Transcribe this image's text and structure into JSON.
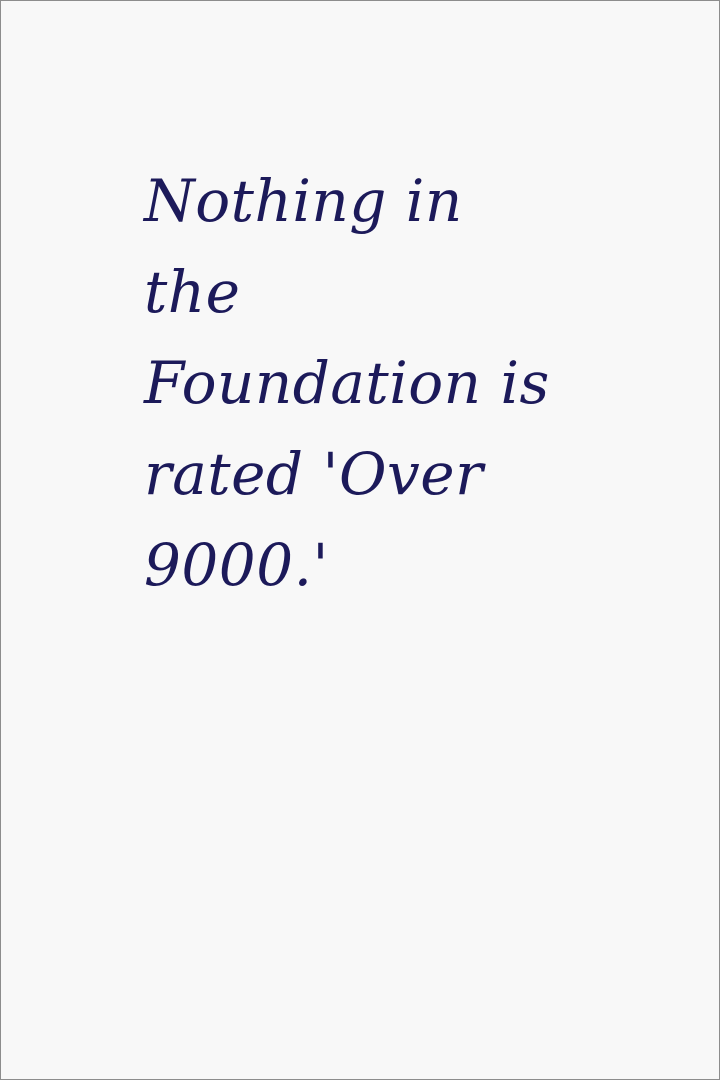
{
  "quote": {
    "lines": [
      "Nothing in",
      "the",
      "Foundation is",
      "rated 'Over",
      "9000.'"
    ]
  },
  "colors": {
    "background": "#f8f8f8",
    "text": "#1c1a5a",
    "border": "#8d8d8d"
  }
}
